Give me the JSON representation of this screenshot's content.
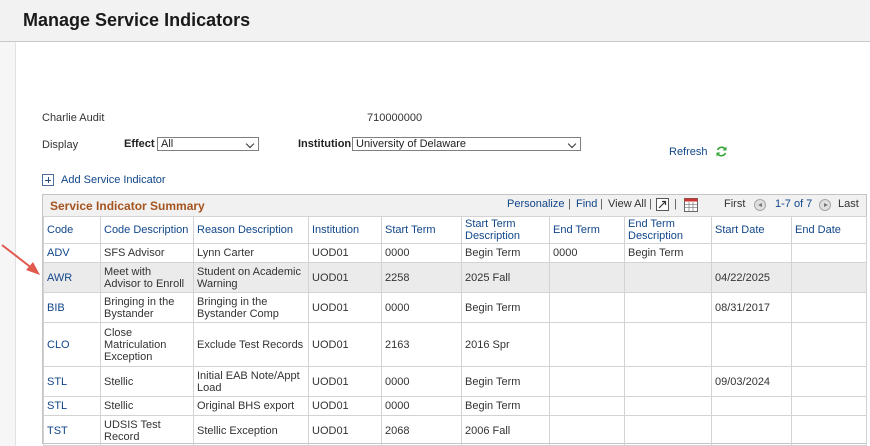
{
  "page": {
    "title": "Manage Service Indicators"
  },
  "person": {
    "name": "Charlie Audit",
    "id": "710000000"
  },
  "filters": {
    "display_label": "Display",
    "effect_label": "Effect",
    "effect_value": "All",
    "institution_label": "Institution",
    "institution_value": "University of Delaware",
    "refresh_label": "Refresh"
  },
  "add_link": "Add Service Indicator",
  "grid": {
    "title": "Service Indicator Summary",
    "nav": {
      "personalize": "Personalize",
      "find": "Find",
      "view_all": "View All",
      "first": "First",
      "range": "1-7 of 7",
      "last": "Last"
    },
    "columns": [
      "Code",
      "Code Description",
      "Reason Description",
      "Institution",
      "Start Term",
      "Start Term Description",
      "End Term",
      "End Term Description",
      "Start Date",
      "End Date"
    ],
    "rows": [
      [
        "ADV",
        "SFS Advisor",
        "Lynn Carter",
        "UOD01",
        "0000",
        "Begin Term",
        "0000",
        "Begin Term",
        "",
        ""
      ],
      [
        "AWR",
        "Meet with Advisor to Enroll",
        "Student on Academic Warning",
        "UOD01",
        "2258",
        "2025 Fall",
        "",
        "",
        "04/22/2025",
        ""
      ],
      [
        "BIB",
        "Bringing in the Bystander",
        "Bringing in the Bystander Comp",
        "UOD01",
        "0000",
        "Begin Term",
        "",
        "",
        "08/31/2017",
        ""
      ],
      [
        "CLO",
        "Close Matriculation Exception",
        "Exclude Test Records",
        "UOD01",
        "2163",
        "2016 Spr",
        "",
        "",
        "",
        ""
      ],
      [
        "STL",
        "Stellic",
        "Initial EAB Note/Appt Load",
        "UOD01",
        "0000",
        "Begin Term",
        "",
        "",
        "09/03/2024",
        ""
      ],
      [
        "STL",
        "Stellic",
        "Original BHS export",
        "UOD01",
        "0000",
        "Begin Term",
        "",
        "",
        "",
        ""
      ],
      [
        "TST",
        "UDSIS Test Record",
        "Stellic Exception",
        "UOD01",
        "2068",
        "2006 Fall",
        "",
        "",
        "",
        ""
      ]
    ]
  },
  "colors": {
    "link": "#11468a",
    "grid_title": "#a6541f",
    "highlight_row": "#ebebeb",
    "annotation_arrow": "#e05a4f"
  },
  "icons": [
    "refresh-icon",
    "add-icon",
    "zoom-icon",
    "download-icon",
    "previous-icon",
    "next-icon",
    "annotation-arrow"
  ]
}
